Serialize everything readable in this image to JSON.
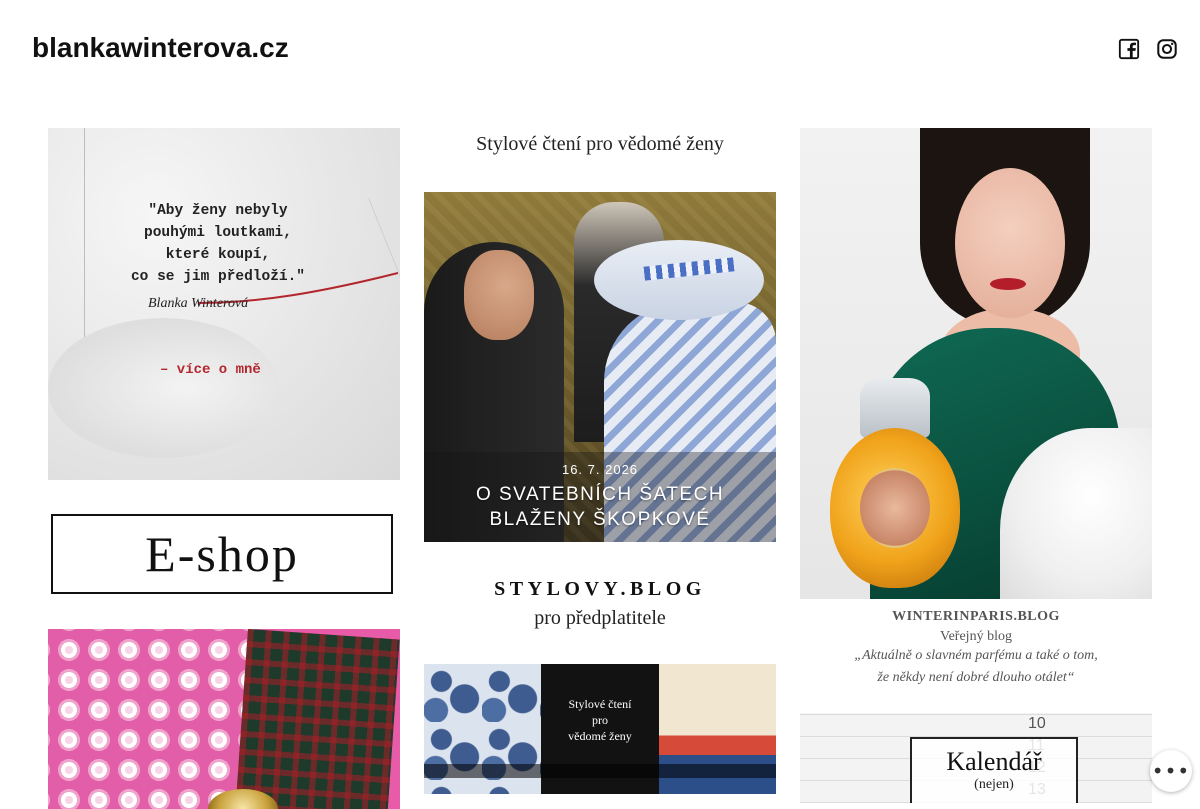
{
  "site": {
    "title": "blankawinterova.cz"
  },
  "social": {
    "facebook_icon": "facebook-icon",
    "instagram_icon": "instagram-icon"
  },
  "left": {
    "quote_text": "\"Aby ženy nebyly\npouhými loutkami,\nkteré koupí,\nco se jim předloží.\"",
    "quote_signature": "Blanka Winterová",
    "quote_link": "– více o mně",
    "eshop_label": "E-shop"
  },
  "middle": {
    "tagline": "Stylové čtení pro vědomé ženy",
    "wedding_date": "16. 7. 2026",
    "wedding_caption": "O SVATEBNÍCH ŠATECH\nBLAŽENY ŠKOPKOVÉ",
    "stylovy_title": "STYLOVY.BLOG",
    "stylovy_sub": "pro předplatitele",
    "collage_text": "Stylové čtení\npro\nvědomé ženy"
  },
  "right": {
    "winter_title": "WINTERINPARIS.BLOG",
    "winter_sub": "Veřejný blog",
    "winter_quote": "„Aktuálně o slavném parfému a také o tom,\nže někdy není dobré dlouho otálet“",
    "calendar_title": "Kalendář",
    "calendar_sub": "(nejen)",
    "calendar_nums": "10\n11\n12\n13"
  },
  "more_button": {
    "label": "•••"
  },
  "colors": {
    "accent_red": "#b3262d",
    "text": "#222222"
  }
}
